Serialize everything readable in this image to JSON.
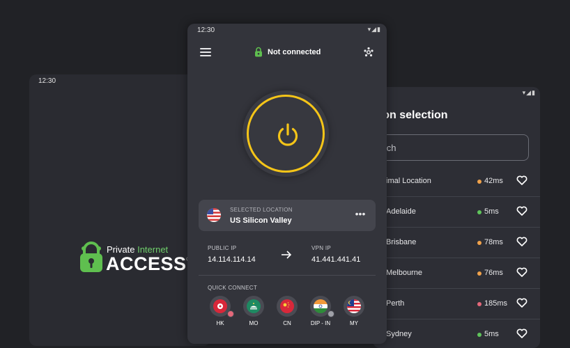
{
  "left_screen": {
    "time": "12:30",
    "brand_line1_a": "Private ",
    "brand_line1_b": "Internet",
    "brand_line2": "ACCESS",
    "brand_mark": "®"
  },
  "main_screen": {
    "time": "12:30",
    "system_icons": "▾◢▮",
    "connection_status": "Not connected",
    "selected_location": {
      "label": "SELECTED LOCATION",
      "value": "US Silicon Valley",
      "more": "•••"
    },
    "public_ip": {
      "label": "PUBLIC IP",
      "value": "14.114.114.14"
    },
    "vpn_ip": {
      "label": "VPN IP",
      "value": "41.441.441.41"
    },
    "quick_connect": {
      "title": "QUICK CONNECT",
      "items": [
        {
          "label": "HK",
          "flag": "hong-kong"
        },
        {
          "label": "MO",
          "flag": "macau"
        },
        {
          "label": "CN",
          "flag": "china"
        },
        {
          "label": "DIP - IN",
          "flag": "india"
        },
        {
          "label": "MY",
          "flag": "malaysia"
        }
      ]
    },
    "accent_color": "#f5c518"
  },
  "region_screen": {
    "system_icons": "▾◢▮",
    "title": "gion selection",
    "search_placeholder": "earch",
    "regions": [
      {
        "name": "imal Location",
        "latency": "42ms",
        "status_color": "#f0a24b"
      },
      {
        "name": "Adelaide",
        "latency": "5ms",
        "status_color": "#5fc45b"
      },
      {
        "name": "Brisbane",
        "latency": "78ms",
        "status_color": "#f0a24b"
      },
      {
        "name": "Melbourne",
        "latency": "76ms",
        "status_color": "#f0a24b"
      },
      {
        "name": "Perth",
        "latency": "185ms",
        "status_color": "#e4687a"
      },
      {
        "name": "Sydney",
        "latency": "5ms",
        "status_color": "#5fc45b"
      }
    ]
  }
}
